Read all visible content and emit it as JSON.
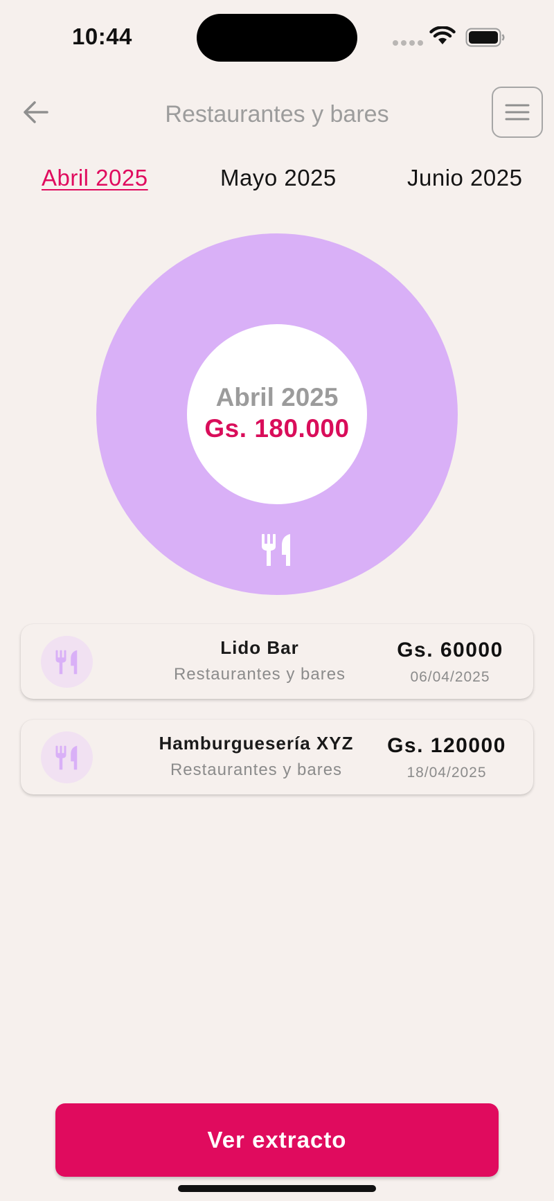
{
  "status_bar": {
    "time": "10:44"
  },
  "header": {
    "title": "Restaurantes y bares"
  },
  "months": {
    "active": "Abril 2025",
    "items": [
      "Abril 2025",
      "Mayo 2025",
      "Junio 2025"
    ]
  },
  "chart_data": {
    "type": "pie",
    "categories": [
      "Restaurantes y bares"
    ],
    "values": [
      180000
    ],
    "center_label": "Abril 2025",
    "center_value": "Gs. 180.000",
    "slice_icon": "restaurant-icon"
  },
  "transactions": [
    {
      "name": "Lido Bar",
      "category": "Restaurantes y bares",
      "amount": "Gs. 60000",
      "date": "06/04/2025",
      "icon": "restaurant-icon"
    },
    {
      "name": "Hamburguesería XYZ",
      "category": "Restaurantes y bares",
      "amount": "Gs. 120000",
      "date": "18/04/2025",
      "icon": "restaurant-icon"
    }
  ],
  "cta": {
    "label": "Ver extracto"
  },
  "colors": {
    "accent": "#e00b5e",
    "slice": "#d9b0f7",
    "background": "#f6f0ed",
    "icon_bg": "#f1e1f2",
    "icon_fg": "#d9b0f7"
  }
}
